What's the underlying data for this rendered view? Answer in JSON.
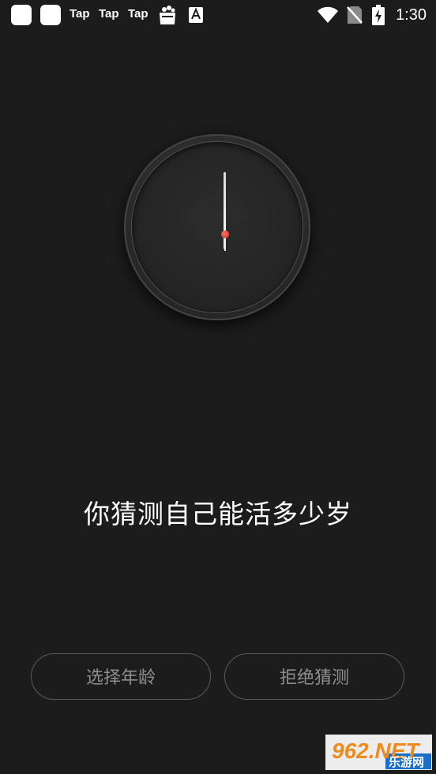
{
  "status_bar": {
    "tap_labels": [
      "Tap",
      "Tap",
      "Tap"
    ],
    "time": "1:30",
    "icons": [
      "app-square-icon",
      "app-square-icon",
      "store-bag-icon",
      "font-a-icon",
      "wifi-icon",
      "no-sim-icon",
      "battery-charging-icon"
    ]
  },
  "clock": {
    "hand_color": "#ffffff",
    "center_color": "#e04a3c"
  },
  "main": {
    "question": "你猜测自己能活多少岁"
  },
  "buttons": {
    "choose_age": "选择年龄",
    "refuse_guess": "拒绝猜测"
  },
  "watermark": {
    "logo_text": "962.NET",
    "site_text": "乐游网"
  },
  "colors": {
    "background": "#1c1c1c",
    "button_border": "#5a5a5a",
    "button_text": "#8e8e8e"
  }
}
